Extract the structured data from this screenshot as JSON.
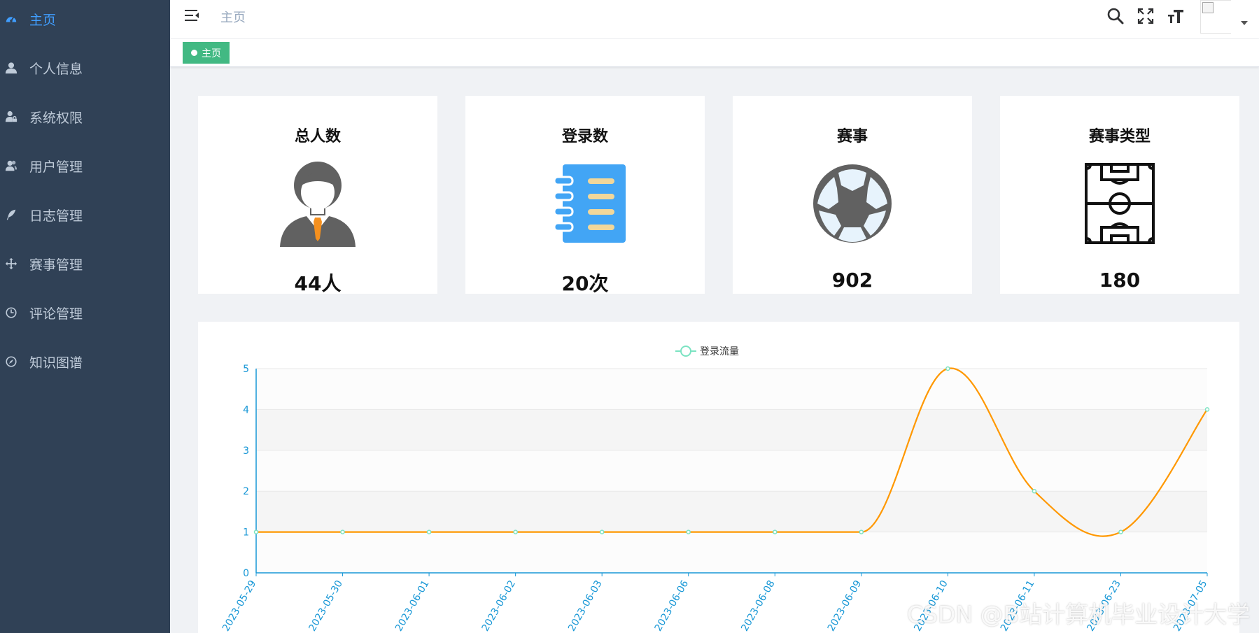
{
  "sidebar": {
    "items": [
      {
        "label": "主页",
        "icon": "dashboard-icon",
        "active": true
      },
      {
        "label": "个人信息",
        "icon": "user-icon",
        "active": false
      },
      {
        "label": "系统权限",
        "icon": "user-lock-icon",
        "active": false
      },
      {
        "label": "用户管理",
        "icon": "users-icon",
        "active": false
      },
      {
        "label": "日志管理",
        "icon": "feather-icon",
        "active": false
      },
      {
        "label": "赛事管理",
        "icon": "move-arrows-icon",
        "active": false
      },
      {
        "label": "评论管理",
        "icon": "clock-icon",
        "active": false
      },
      {
        "label": "知识图谱",
        "icon": "compass-icon",
        "active": false
      }
    ]
  },
  "header": {
    "breadcrumb": "主页",
    "icons": [
      "search-icon",
      "fullscreen-icon",
      "font-size-icon",
      "avatar",
      "dropdown-caret-icon"
    ]
  },
  "tags": {
    "active_tag": "主页",
    "active_color": "#42b983"
  },
  "cards": [
    {
      "title": "总人数",
      "value": "44人",
      "icon": "person-icon"
    },
    {
      "title": "登录数",
      "value": "20次",
      "icon": "notebook-icon"
    },
    {
      "title": "赛事",
      "value": "902",
      "icon": "soccer-ball-icon"
    },
    {
      "title": "赛事类型",
      "value": "180",
      "icon": "football-pitch-icon"
    }
  ],
  "chart_data": {
    "type": "line",
    "title": "",
    "xlabel": "",
    "ylabel": "",
    "legend": {
      "label": "登录流量",
      "placement": "top-center"
    },
    "categories": [
      "2023-05-29",
      "2023-05-30",
      "2023-06-01",
      "2023-06-02",
      "2023-06-03",
      "2023-06-06",
      "2023-06-08",
      "2023-06-09",
      "2023-06-10",
      "2023-06-11",
      "2023-06-23",
      "2023-07-05"
    ],
    "series": [
      {
        "name": "登录流量",
        "values": [
          1,
          1,
          1,
          1,
          1,
          1,
          1,
          1,
          5,
          2,
          1,
          4
        ],
        "color": "#ff9800",
        "smooth": true
      }
    ],
    "ylim": [
      0,
      5
    ],
    "yticks": [
      "0",
      "1",
      "2",
      "3",
      "4",
      "5"
    ],
    "grid": "horizontal-split-area",
    "axis_color": "#1797d6",
    "point_color": "#7be3c2"
  },
  "colors": {
    "sidebar_bg": "#304156",
    "sidebar_text": "#bfcbd9",
    "sidebar_active": "#409eff"
  },
  "watermark": "CSDN @B站计算机毕业设计大学"
}
